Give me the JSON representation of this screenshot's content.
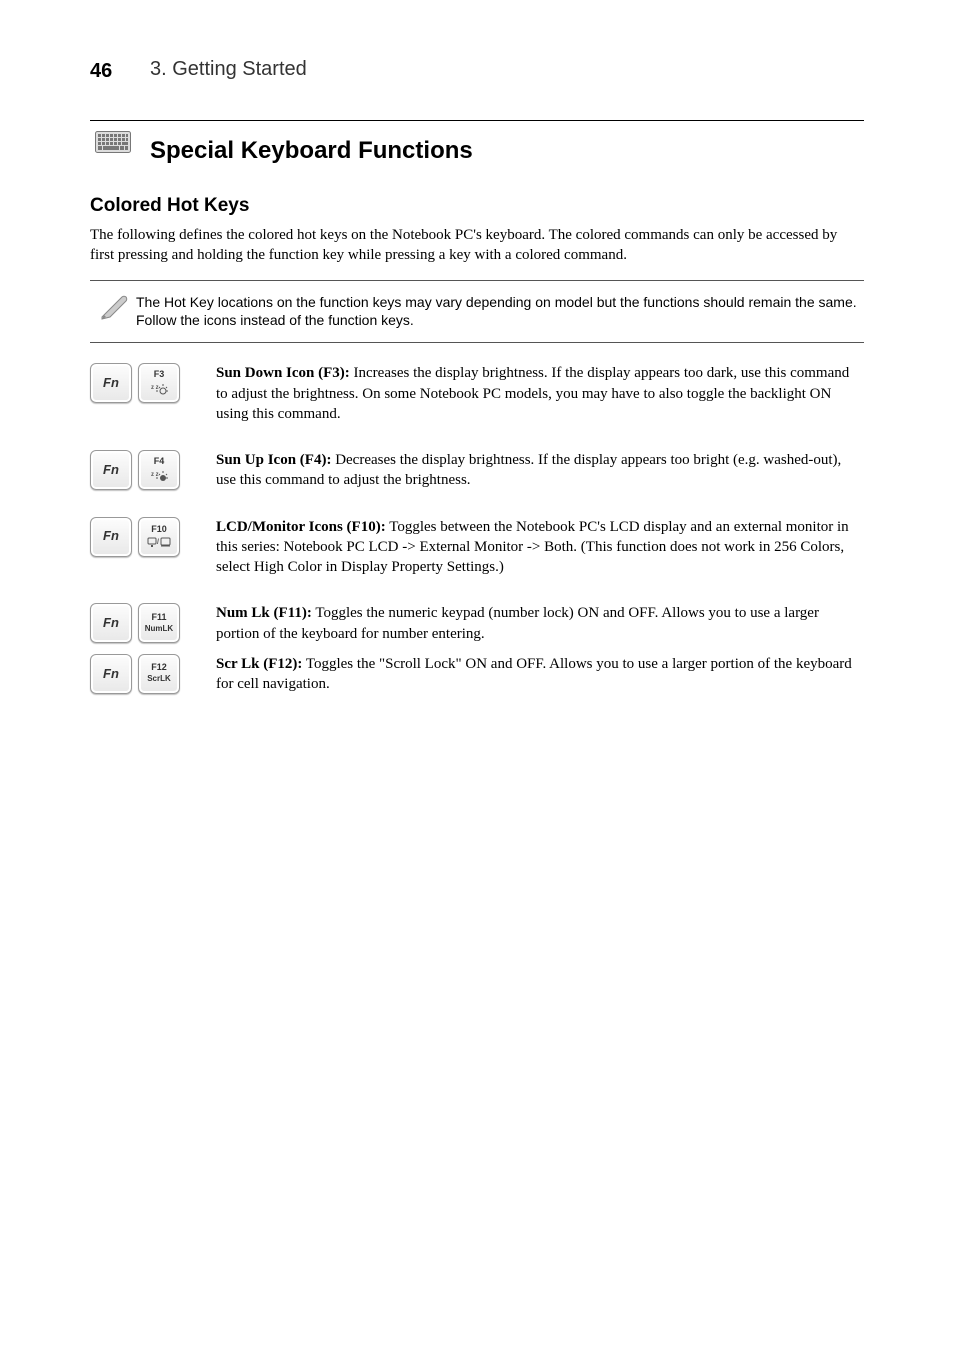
{
  "page_number": "46",
  "running_head": "3.  Getting Started",
  "section_title": "Special Keyboard Functions",
  "colored_hotkeys": {
    "title": "Colored Hot Keys",
    "intro": "The following defines the colored hot keys on the Notebook PC's keyboard. The colored commands can only be accessed by first pressing and holding the function key while pressing a key with a colored command."
  },
  "note": "The Hot Key locations on the function keys may vary depending on model but the functions should remain the same. Follow the icons instead of the function keys.",
  "keys": {
    "fn": "Fn",
    "f3": "F3",
    "f4": "F4",
    "f10": "F10",
    "f11_top": "F11",
    "f11_bot": "NumLK",
    "f12_top": "F12",
    "f12_bot": "ScrLK"
  },
  "items": {
    "f3": {
      "lead": "Sun Down Icon (F3):",
      "text": " Increases the display brightness. If the display appears too dark, use this command to adjust the brightness. On some Notebook PC models, you may have to also toggle the backlight ON using this command."
    },
    "f4": {
      "lead": "Sun Up Icon (F4):",
      "text": " Decreases the display brightness. If the display appears too bright (e.g. washed-out), use this command to adjust the brightness."
    },
    "f10": {
      "lead": "LCD/Monitor Icons (F10):",
      "text": " Toggles between the Notebook PC's LCD display and an external monitor in this series: Notebook PC LCD -> External Monitor -> Both. (This function does not work in 256 Colors, select High Color in Display Property Settings.)"
    },
    "f11": {
      "lead": "Num Lk (F11):",
      "text": " Toggles the numeric keypad (number lock) ON and OFF. Allows you to use a larger portion of the keyboard for number entering."
    },
    "f12": {
      "lead": "Scr Lk (F12):",
      "text": " Toggles the \"Scroll Lock\" ON and OFF. Allows you to use a larger portion of the keyboard for cell navigation."
    }
  }
}
